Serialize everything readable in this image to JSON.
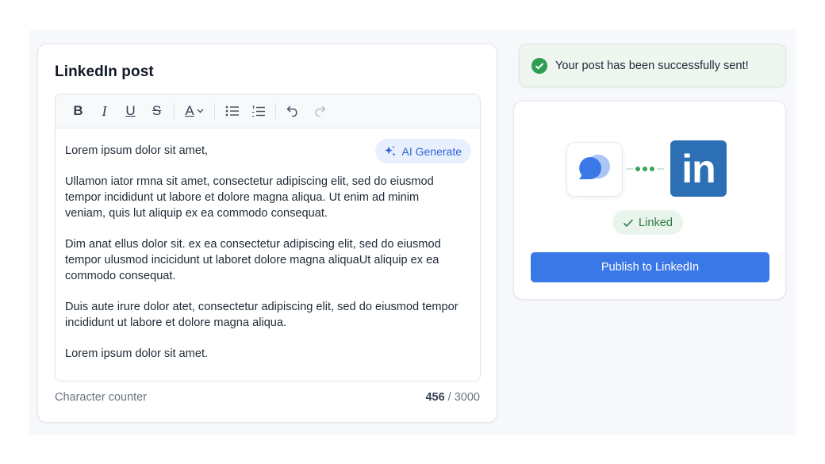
{
  "editor": {
    "title": "LinkedIn post",
    "toolbar": {
      "bold": "B",
      "italic": "I",
      "underline": "U",
      "strike": "S",
      "font_color": "A"
    },
    "ai_generate_label": "AI Generate",
    "paragraphs": [
      "Lorem ipsum dolor sit amet,",
      "Ullamon iator rmna sit amet, consectetur adipiscing elit, sed do eiusmod tempor incididunt ut labore et dolore magna aliqua. Ut enim ad minim veniam, quis lut aliquip ex ea commodo consequat.",
      "Dim anat ellus dolor sit. ex ea consectetur adipiscing elit, sed do eiusmod tempor ulusmod incicidunt ut laboret dolore magna aliquaUt aliquip ex ea commodo consequat.",
      "Duis aute irure dolor atet, consectetur adipiscing elit, sed do eiusmod tempor incididunt ut labore et dolore magna aliqua.",
      "Lorem ipsum dolor sit amet."
    ],
    "counter_label": "Character counter",
    "counter_current": "456",
    "counter_separator": " / ",
    "counter_max": "3000"
  },
  "toast": {
    "message": "Your post has been successfully sent!"
  },
  "publish": {
    "linkedin_logo_text": "in",
    "linked_label": "Linked",
    "button_label": "Publish to LinkedIn"
  },
  "colors": {
    "accent": "#3b78e7",
    "success": "#3aa55a",
    "linkedin": "#2d6fb5"
  }
}
